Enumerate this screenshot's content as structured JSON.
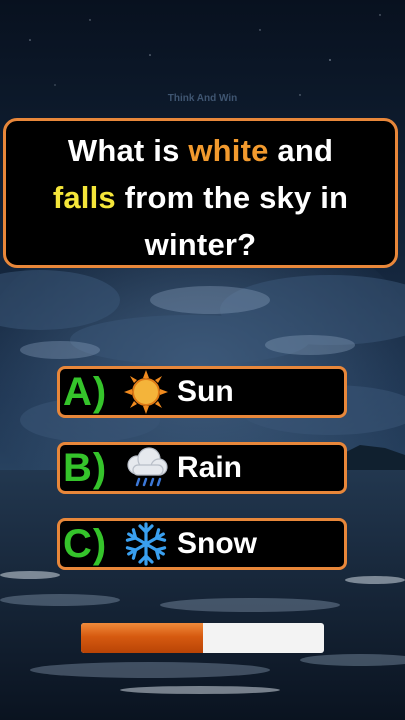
{
  "watermark": "Think And Win",
  "question": {
    "line1_pre": "What is ",
    "line1_highlight": "white",
    "line1_post": " and",
    "line2_highlight": "falls",
    "line2_post": " from the sky in",
    "line3": "winter?",
    "colors": {
      "border": "#e8873a",
      "highlight1": "#f29a2e",
      "highlight2": "#f5e63a"
    }
  },
  "options": [
    {
      "letter": "A)",
      "icon": "sun-icon",
      "text": "Sun"
    },
    {
      "letter": "B)",
      "icon": "rain-cloud-icon",
      "text": "Rain"
    },
    {
      "letter": "C)",
      "icon": "snowflake-icon",
      "text": "Snow"
    }
  ],
  "timer": {
    "progress": 0.5,
    "fill_color": "#d65a10"
  }
}
